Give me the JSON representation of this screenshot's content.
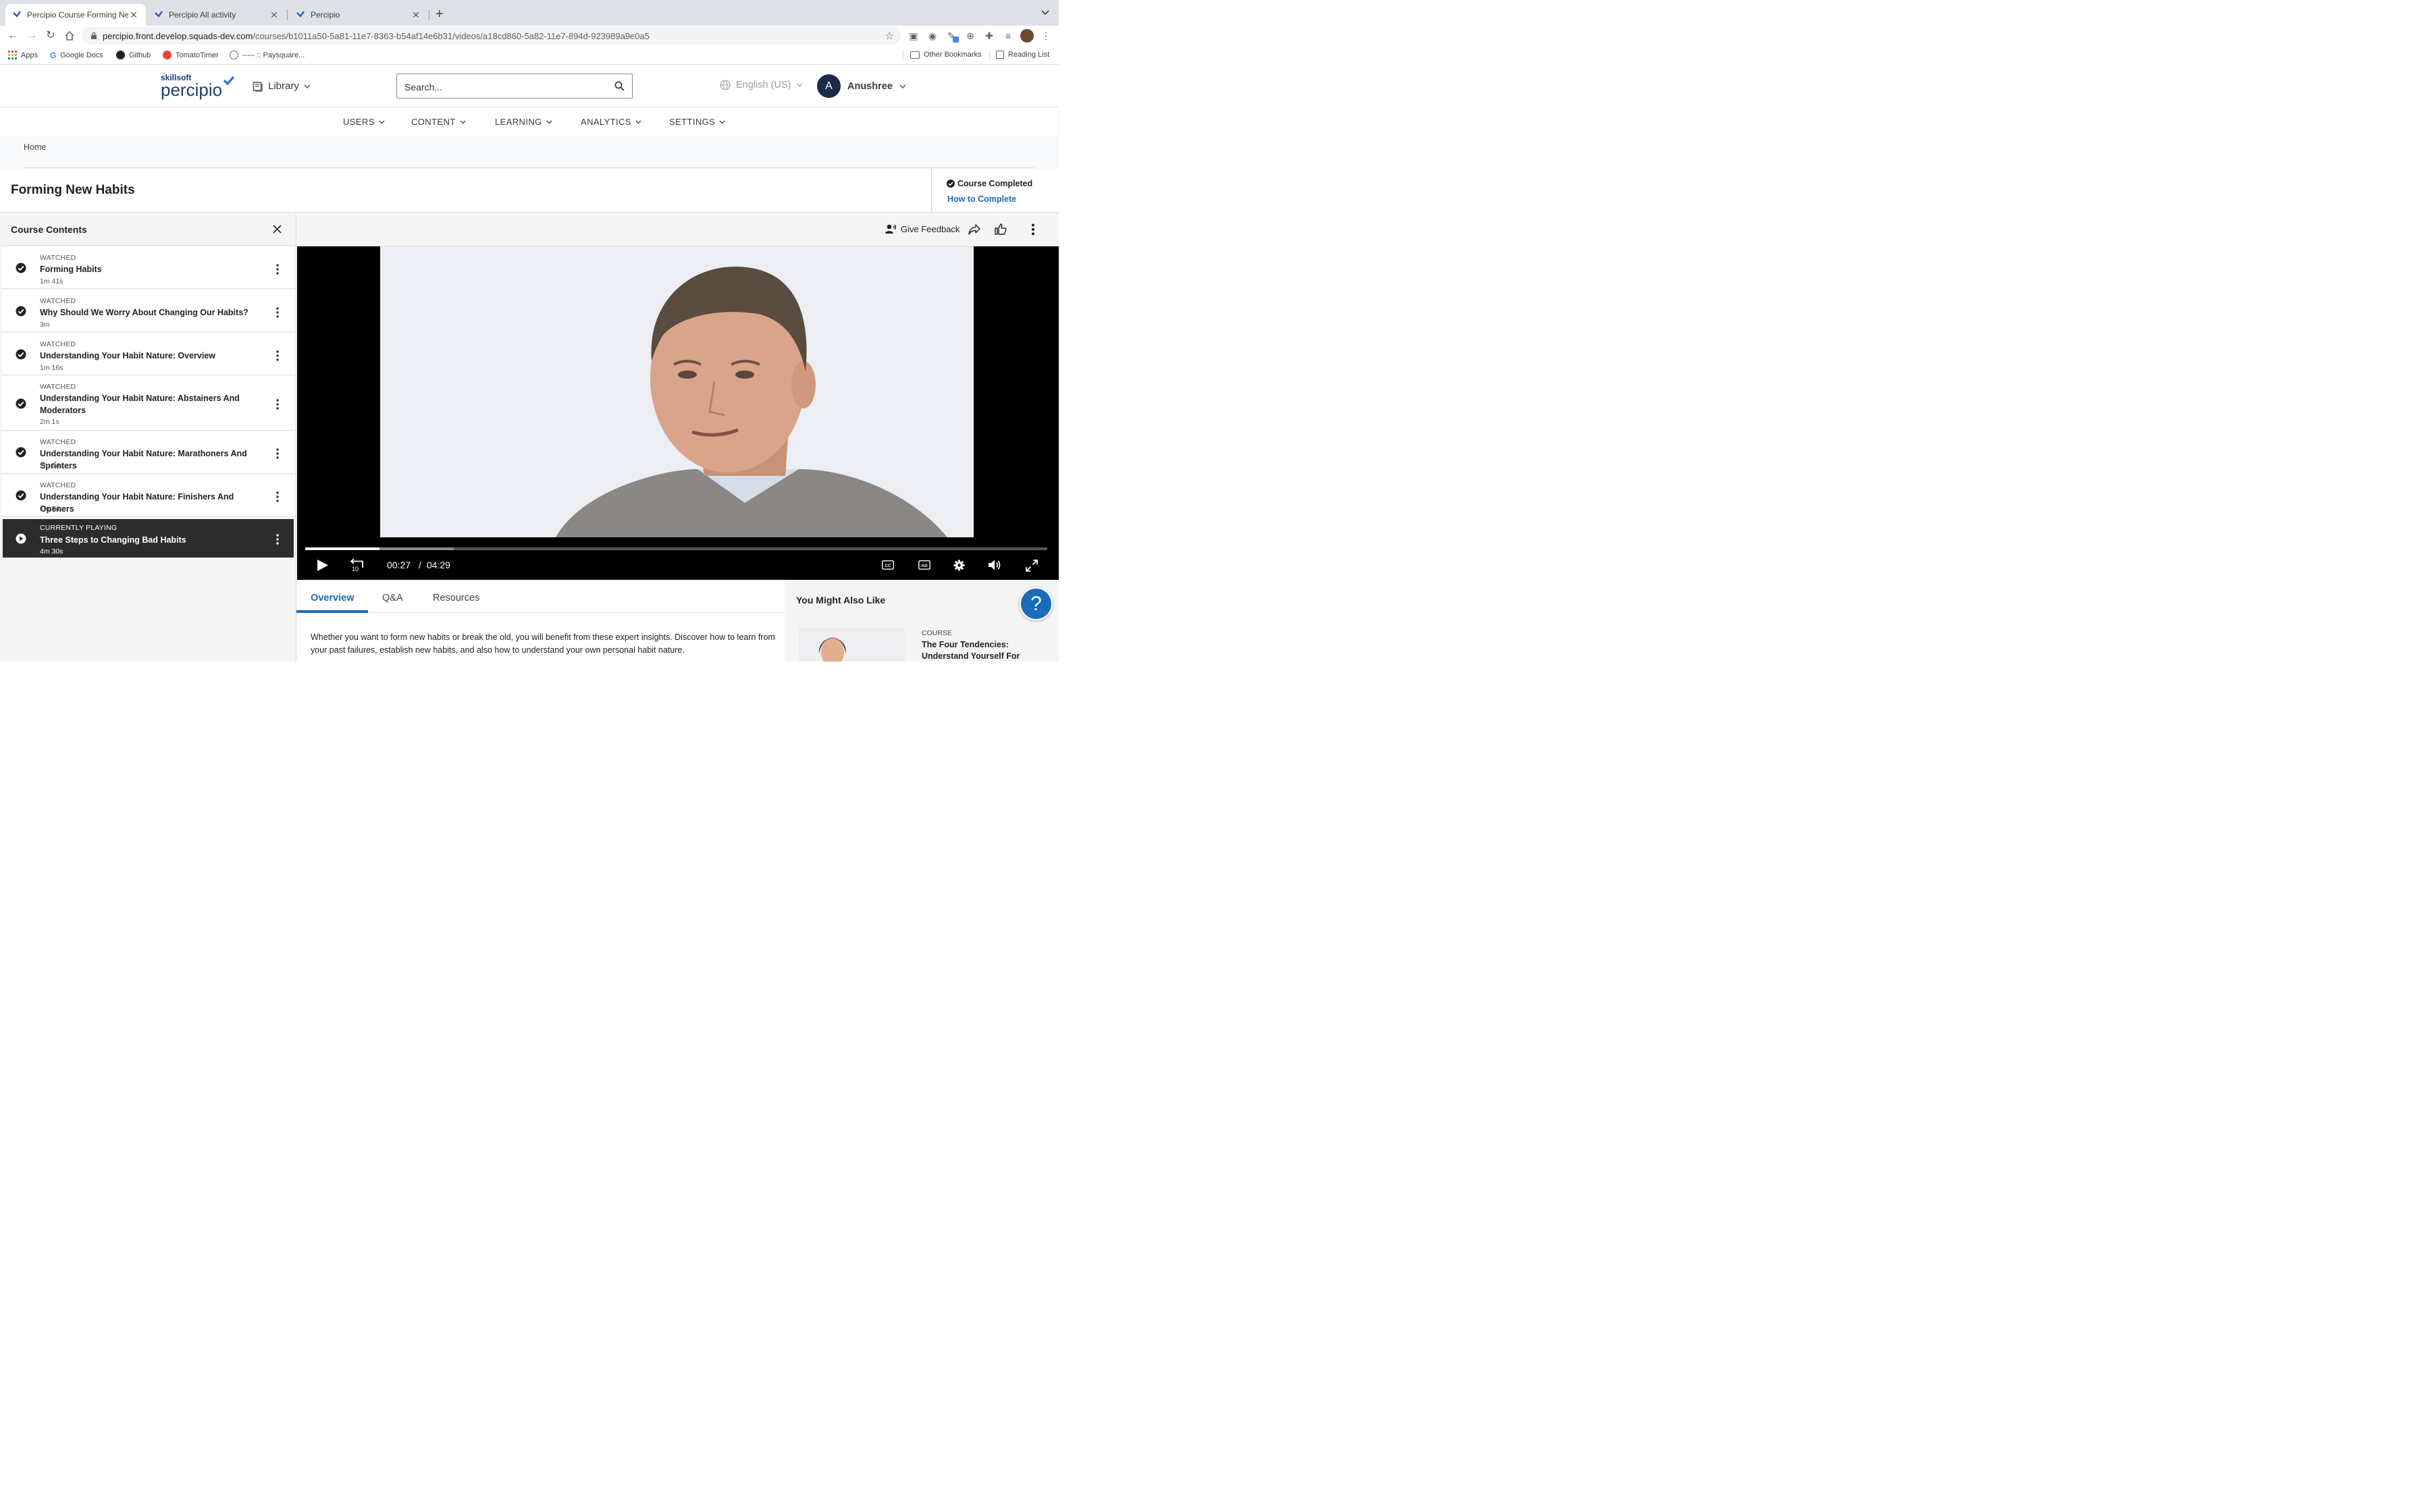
{
  "browser": {
    "tabs": [
      {
        "title": "Percipio Course Forming New H",
        "active": true
      },
      {
        "title": "Percipio All activity",
        "active": false
      },
      {
        "title": "Percipio",
        "active": false
      }
    ],
    "url_host": "percipio.front.develop.squads-dev.com",
    "url_path": "/courses/b1011a50-5a81-11e7-8363-b54af14e6b31/videos/a18cd860-5a82-11e7-894d-923989a9e0a5",
    "bookmarks": [
      "Apps",
      "Google Docs",
      "Github",
      "TomatoTimer",
      "----- :: Paysquare..."
    ],
    "other_bookmarks": "Other Bookmarks",
    "reading_list": "Reading List"
  },
  "header": {
    "brand_small": "skillsoft",
    "brand": "percipio",
    "library": "Library",
    "search_placeholder": "Search...",
    "language": "English (US)",
    "avatar_initial": "A",
    "user": "Anushree"
  },
  "nav": [
    "USERS",
    "CONTENT",
    "LEARNING",
    "ANALYTICS",
    "SETTINGS"
  ],
  "breadcrumb": "Home",
  "course": {
    "title": "Forming New Habits",
    "completed": "Course Completed",
    "how_to_complete": "How to Complete"
  },
  "sidebar": {
    "title": "Course Contents",
    "items": [
      {
        "status": "WATCHED",
        "name": "Forming Habits",
        "duration": "1m 41s"
      },
      {
        "status": "WATCHED",
        "name": "Why Should We Worry About Changing Our Habits?",
        "duration": "3m"
      },
      {
        "status": "WATCHED",
        "name": "Understanding Your Habit Nature: Overview",
        "duration": "1m 16s"
      },
      {
        "status": "WATCHED",
        "name": "Understanding Your Habit Nature: Abstainers And Moderators",
        "duration": "2m 1s"
      },
      {
        "status": "WATCHED",
        "name": "Understanding Your Habit Nature: Marathoners And Sprinters",
        "duration": "2m 24s"
      },
      {
        "status": "WATCHED",
        "name": "Understanding Your Habit Nature: Finishers And Openers",
        "duration": "1m 54s"
      },
      {
        "status": "CURRENTLY PLAYING",
        "name": "Three Steps to Changing Bad Habits",
        "duration": "4m 30s"
      }
    ]
  },
  "video": {
    "give_feedback": "Give Feedback",
    "current_time": "00:27",
    "separator": "/",
    "total_time": "04:29",
    "progress": 0.1,
    "buffered": 0.2,
    "rewind_label": "10"
  },
  "tabs": {
    "items": [
      "Overview",
      "Q&A",
      "Resources"
    ],
    "active": 0,
    "overview_text": "Whether you want to form new habits or break the old, you will benefit from these expert insights. Discover how to learn from your past failures, establish new habits, and also how to understand your own personal habit nature."
  },
  "recommend": {
    "title": "You Might Also Like",
    "card_type": "COURSE",
    "card_title": "The Four Tendencies: Understand Yourself For"
  },
  "help": "?",
  "colors": {
    "accent": "#1a6bb8",
    "dark": "#2c2c2c",
    "navy": "#1c2b4b"
  }
}
